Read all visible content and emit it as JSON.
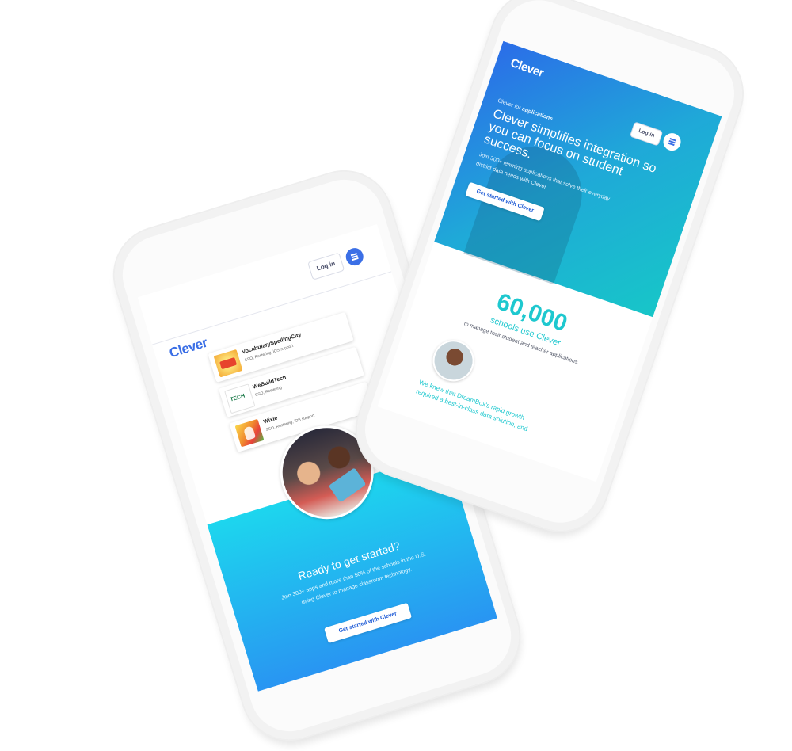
{
  "left_phone": {
    "logo": "Clever",
    "login_label": "Log in",
    "apps": [
      {
        "name": "VocabularySpellingCity",
        "features": "SSO, Rostering, iOS support",
        "thumb_icon": "vocabulary-spelling-city-logo"
      },
      {
        "name": "WeBuildTech",
        "features": "SSO, Rostering",
        "thumb_icon": "webuildtech-logo",
        "thumb_text": "TECH"
      },
      {
        "name": "Wixie",
        "features": "SSO, Rostering, iOS support",
        "thumb_icon": "wixie-logo"
      }
    ],
    "cta_section": {
      "title": "Ready to get started?",
      "body": "Join 300+ apps and more than 50% of the schools in the U.S. using Clever to manage classroom technology.",
      "button_label": "Get started with Clever"
    }
  },
  "right_phone": {
    "logo": "Clever",
    "login_label": "Log in",
    "eyebrow_prefix": "Clever for",
    "eyebrow_bold": "applications",
    "headline": "Clever simplifies integration so you can focus on student success.",
    "subtext": "Join 300+ learning applications that solve their everyday district data needs with Clever.",
    "button_label": "Get started with Clever",
    "stat_number": "60,000",
    "stat_label": "schools use Clever",
    "stat_caption": "to manage their student and teacher applications.",
    "quote": "We knew that DreamBox's rapid growth required a best-in-class data solution, and"
  },
  "colors": {
    "brand_blue": "#2f6fe4",
    "teal": "#1ec8cf",
    "gradient_cyan": "#18d8f0",
    "gradient_blue": "#2a8ff2"
  }
}
